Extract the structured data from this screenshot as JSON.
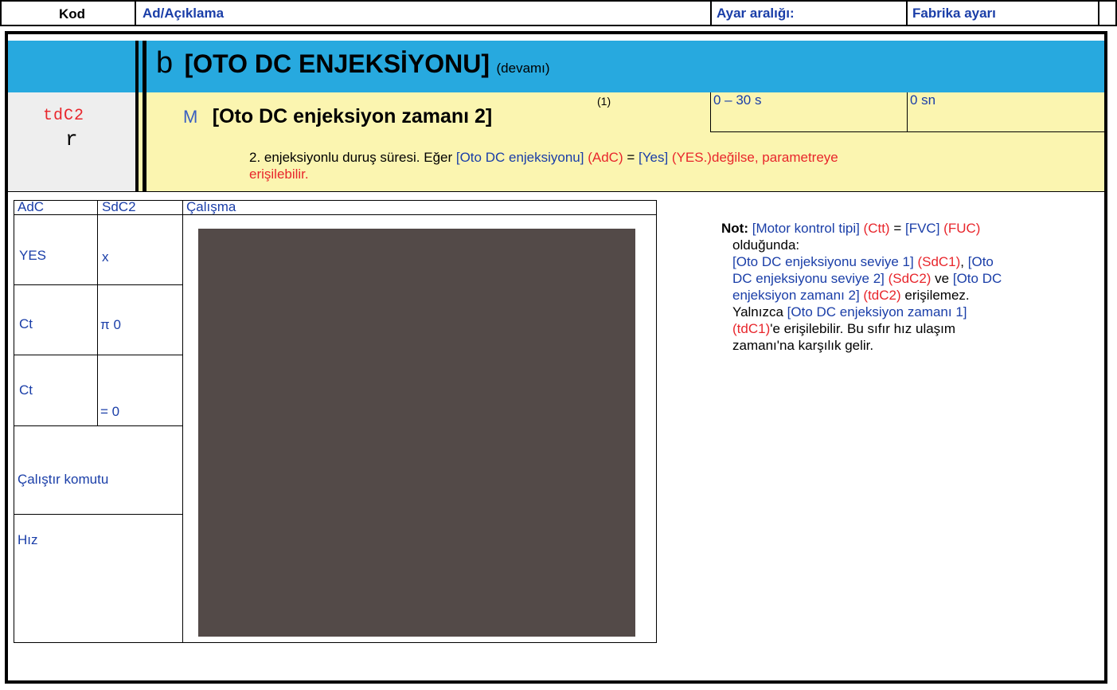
{
  "header": {
    "code": "Kod",
    "name": "Ad/Açıklama",
    "range": "Ayar aralığı:",
    "factory": "Fabrika ayarı"
  },
  "section": {
    "icon_letter": "b",
    "title": "[OTO DC ENJEKSİYONU]",
    "suffix": "(devamı)"
  },
  "param": {
    "code": "tdC2",
    "code_glyph": "r",
    "menu_letter": "M",
    "name": "[Oto DC enjeksiyon zamanı 2]",
    "footnote": "(1)",
    "range": "0 – 30 s",
    "factory": "0 sn",
    "desc_part1": "2. enjeksiyonlu duruş süresi. Eğer ",
    "desc_link1": "[Oto DC enjeksiyonu]",
    "desc_code1": " (AdC)",
    "desc_eq": " = ",
    "desc_link2": "[Yes]",
    "desc_code2": " (YES.)",
    "desc_part2": "değilse, parametreye",
    "desc_part3": "erişilebilir."
  },
  "table": {
    "headers": [
      "AdC",
      "SdC2",
      "Çalışma"
    ],
    "rows": [
      {
        "adc": "YES",
        "sdc2": "x"
      },
      {
        "adc": "Ct",
        "sdc2": "π 0"
      },
      {
        "adc": "Ct",
        "sdc2": "= 0"
      }
    ],
    "run_command": "Çalıştır komutu",
    "speed": "Hız"
  },
  "note": {
    "label": "Not:",
    "l1_link": "[Motor kontrol tipi]",
    "l1_code": " (Ctt)",
    "l1_eq": " = ",
    "l1_link2": "[FVC]",
    "l1_code2": " (FUC)",
    "l2": "olduğunda:",
    "l3_link": "[Oto DC enjeksiyonu seviye 1]",
    "l3_code": " (SdC1)",
    "l3_sep": ", ",
    "l3_link2": "[Oto",
    "l4_link": "DC enjeksiyonu seviye 2]",
    "l4_code": " (SdC2)",
    "l4_text": " ve ",
    "l4_link2": "[Oto DC",
    "l5_link": "enjeksiyon zamanı 2]",
    "l5_code": " (tdC2)",
    "l5_text": " erişilemez.",
    "l6_text": "Yalnızca ",
    "l6_link": "[Oto DC enjeksiyon zamanı 1]",
    "l7_code": "(tdC1)",
    "l7_text": "'e erişilebilir. Bu sıfır hız ulaşım",
    "l8_text": "zamanı'na karşılık gelir."
  },
  "colors": {
    "cyan": "#27a9df",
    "yellow": "#fbf5b0",
    "link_blue": "#1a3ea8",
    "code_red": "#e8262c",
    "graph": "#534a48"
  }
}
